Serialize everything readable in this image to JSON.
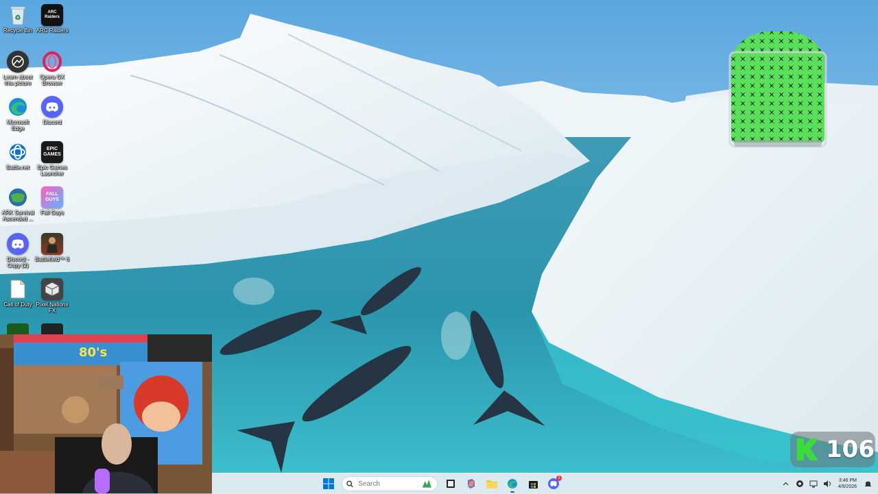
{
  "desktop": {
    "icons": [
      {
        "label": "Recycle Bin",
        "icon": "recycle-bin-icon"
      },
      {
        "label": "ARC Raiders",
        "icon": "arc-raiders-icon",
        "badge": "ARC Raiders"
      },
      {
        "label": "Learn about this picture",
        "icon": "learn-about-picture-icon"
      },
      {
        "label": "Opera GX Browser",
        "icon": "opera-gx-icon"
      },
      {
        "label": "Microsoft Edge",
        "icon": "edge-icon"
      },
      {
        "label": "Discord",
        "icon": "discord-icon"
      },
      {
        "label": "Battle.net",
        "icon": "battlenet-icon"
      },
      {
        "label": "Epic Games Launcher",
        "icon": "epic-games-icon",
        "badge": "EPIC GAMES"
      },
      {
        "label": "ARK Survival Ascended ...",
        "icon": "ark-survival-icon"
      },
      {
        "label": "Fall Guys",
        "icon": "fall-guys-icon",
        "badge": "FALL GUYS"
      },
      {
        "label": "Discord - Copy (2)",
        "icon": "discord-copy-icon"
      },
      {
        "label": "Battlefield™ 6",
        "icon": "battlefield-icon"
      },
      {
        "label": "Call of Duty",
        "icon": "call-of-duty-file-icon"
      },
      {
        "label": "Pixel Nations FX",
        "icon": "pixel-nations-icon"
      }
    ]
  },
  "webcam": {
    "sign_text": "80's"
  },
  "counter_widget": {
    "letter": "K",
    "value": "106"
  },
  "taskbar": {
    "search_placeholder": "Search",
    "clock_time": "3:46 PM",
    "clock_date": "4/9/2026",
    "discord_badge": "1"
  },
  "colors": {
    "accent": "#0067c0",
    "counter_green": "#3ddc3d",
    "taskbar_bg": "#e8eef3"
  }
}
